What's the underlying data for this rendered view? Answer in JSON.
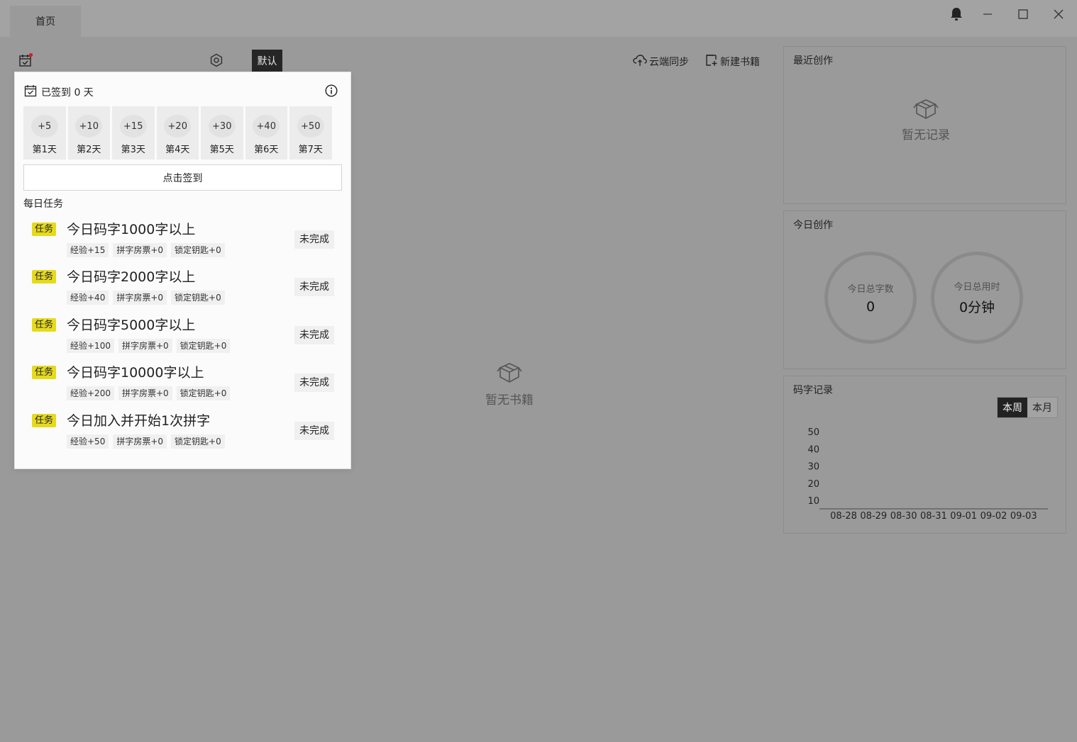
{
  "window": {
    "tab_home": "首页"
  },
  "toolbar": {
    "default_label": "默认",
    "cloud_sync": "云端同步",
    "new_book": "新建书籍"
  },
  "center": {
    "empty_text": "暂无书籍"
  },
  "recent": {
    "title": "最近创作",
    "empty_text": "暂无记录"
  },
  "today": {
    "title": "今日创作",
    "words_label": "今日总字数",
    "words_value": "0",
    "time_label": "今日总用时",
    "time_value": "0分钟"
  },
  "record": {
    "title": "码字记录",
    "week_label": "本周",
    "month_label": "本月"
  },
  "chart_data": {
    "type": "line",
    "x": [
      "08-28",
      "08-29",
      "08-30",
      "08-31",
      "09-01",
      "09-02",
      "09-03"
    ],
    "y_ticks": [
      "50",
      "40",
      "30",
      "20",
      "10"
    ],
    "series": [
      {
        "values": [
          0,
          0,
          0,
          0,
          0,
          0,
          0
        ]
      }
    ],
    "ylim": [
      0,
      50
    ]
  },
  "signin": {
    "header": "已签到 0 天",
    "days": [
      {
        "points": "+5",
        "label": "第1天"
      },
      {
        "points": "+10",
        "label": "第2天"
      },
      {
        "points": "+15",
        "label": "第3天"
      },
      {
        "points": "+20",
        "label": "第4天"
      },
      {
        "points": "+30",
        "label": "第5天"
      },
      {
        "points": "+40",
        "label": "第6天"
      },
      {
        "points": "+50",
        "label": "第7天"
      }
    ],
    "button": "点击签到",
    "daily_title": "每日任务",
    "tasks": [
      {
        "badge": "任务",
        "title": "今日码字1000字以上",
        "r1": "经验+15",
        "r2": "拼字房票+0",
        "r3": "锁定钥匙+0",
        "status": "未完成"
      },
      {
        "badge": "任务",
        "title": "今日码字2000字以上",
        "r1": "经验+40",
        "r2": "拼字房票+0",
        "r3": "锁定钥匙+0",
        "status": "未完成"
      },
      {
        "badge": "任务",
        "title": "今日码字5000字以上",
        "r1": "经验+100",
        "r2": "拼字房票+0",
        "r3": "锁定钥匙+0",
        "status": "未完成"
      },
      {
        "badge": "任务",
        "title": "今日码字10000字以上",
        "r1": "经验+200",
        "r2": "拼字房票+0",
        "r3": "锁定钥匙+0",
        "status": "未完成"
      },
      {
        "badge": "任务",
        "title": "今日加入并开始1次拼字",
        "r1": "经验+50",
        "r2": "拼字房票+0",
        "r3": "锁定钥匙+0",
        "status": "未完成"
      }
    ]
  }
}
